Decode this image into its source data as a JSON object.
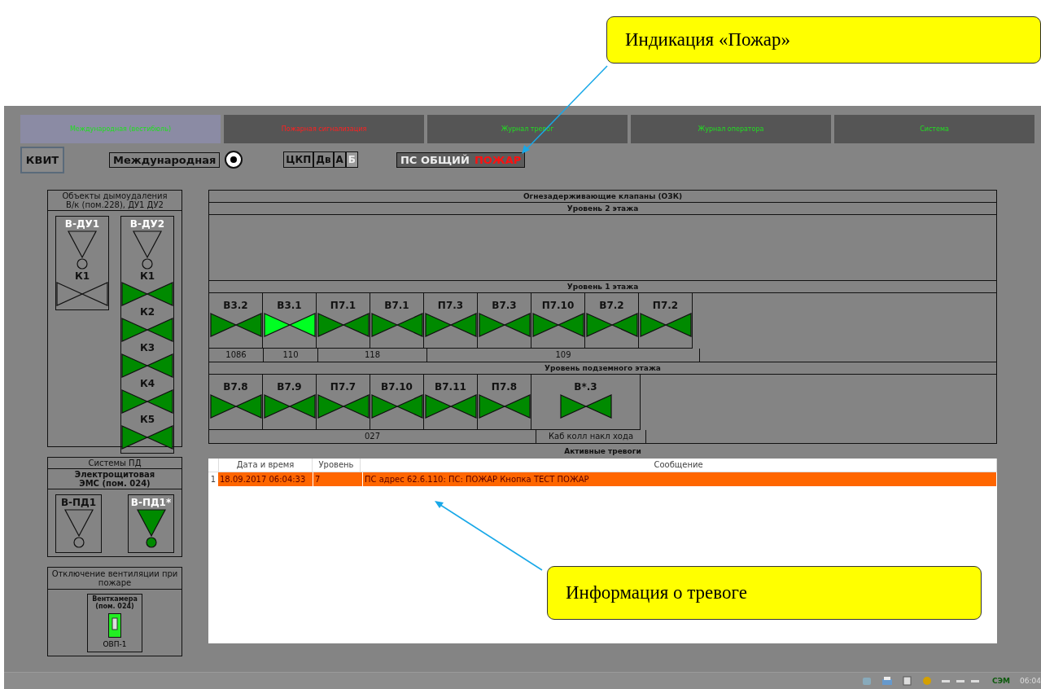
{
  "callouts": [
    {
      "text": "Индикация «Пожар»"
    },
    {
      "text": "Информация о тревоге"
    }
  ],
  "tabs": [
    {
      "label": "Международная (вестибюль)",
      "selected": true,
      "alert": false
    },
    {
      "label": "Пожарная сигнализация",
      "selected": false,
      "alert": true
    },
    {
      "label": "Журнал тревог",
      "selected": false,
      "alert": false
    },
    {
      "label": "Журнал оператора",
      "selected": false,
      "alert": false
    },
    {
      "label": "Система",
      "selected": false,
      "alert": false
    }
  ],
  "toolbar": {
    "ack_button": "КВИТ",
    "station": "Международная",
    "station_selected": true,
    "modes": [
      {
        "label": "ЦКП",
        "disabled": false
      },
      {
        "label": "Дв",
        "disabled": false
      },
      {
        "label": "А",
        "disabled": false
      },
      {
        "label": "Б",
        "disabled": true
      }
    ],
    "fire_panel": {
      "label": "ПС ОБЩИЙ",
      "alarm": "ПОЖАР"
    }
  },
  "smoke_panel": {
    "title": "Объекты дымоудаления",
    "subtitle": "В/к (пом.228), ДУ1 ДУ2",
    "units": [
      {
        "name": "В-ДУ1",
        "fan_on": false,
        "valves": [
          {
            "name": "К1",
            "kind": "off"
          }
        ]
      },
      {
        "name": "В-ДУ2",
        "fan_on": false,
        "valves": [
          {
            "name": "К1",
            "kind": "open"
          },
          {
            "name": "К2",
            "kind": "open"
          },
          {
            "name": "К3",
            "kind": "open"
          },
          {
            "name": "К4",
            "kind": "open"
          },
          {
            "name": "К5",
            "kind": "open"
          }
        ]
      }
    ]
  },
  "pd_panel": {
    "title": "Системы ПД",
    "subtitle": "Электрощитовая\nЭМС (пом. 024)",
    "units": [
      {
        "name": "В-ПД1",
        "fan_on": false
      },
      {
        "name": "В-ПД1*",
        "fan_on": true
      }
    ]
  },
  "vent_panel": {
    "title": "Отключение вентиляции при пожаре",
    "room": "Венткамера\n(пом. 024)",
    "switch_on": true,
    "switch_label": "ОВП-1"
  },
  "dampers": {
    "title": "Огнезадерживающие клапаны (ОЗК)",
    "levels": [
      {
        "title": "Уровень 2 этажа"
      },
      {
        "title": "Уровень 1 этажа",
        "rooms": [
          {
            "label": "1086",
            "valves": [
              {
                "name": "В3.2",
                "kind": "open"
              }
            ]
          },
          {
            "label": "110",
            "valves": [
              {
                "name": "В3.1",
                "kind": "active"
              }
            ]
          },
          {
            "label": "118",
            "valves": [
              {
                "name": "П7.1",
                "kind": "open"
              },
              {
                "name": "В7.1",
                "kind": "open"
              }
            ]
          },
          {
            "label": "109",
            "valves": [
              {
                "name": "П7.3",
                "kind": "open"
              },
              {
                "name": "В7.3",
                "kind": "open"
              },
              {
                "name": "П7.10",
                "kind": "open"
              },
              {
                "name": "В7.2",
                "kind": "open"
              },
              {
                "name": "П7.2",
                "kind": "open"
              }
            ]
          }
        ]
      },
      {
        "title": "Уровень подземного этажа",
        "rooms": [
          {
            "label": "027",
            "valves": [
              {
                "name": "В7.8",
                "kind": "open"
              },
              {
                "name": "В7.9",
                "kind": "open"
              },
              {
                "name": "П7.7",
                "kind": "open"
              },
              {
                "name": "В7.10",
                "kind": "open"
              },
              {
                "name": "В7.11",
                "kind": "open"
              },
              {
                "name": "П7.8",
                "kind": "open"
              }
            ]
          },
          {
            "label": "Каб колл накл хода",
            "valves": [
              {
                "name": "В*.3",
                "kind": "open",
                "wide": true
              }
            ]
          }
        ]
      }
    ]
  },
  "alarms": {
    "title": "Активные тревоги",
    "columns": [
      "Дата и время",
      "Уровень",
      "Сообщение"
    ],
    "rows": [
      {
        "number": "1",
        "time": "18.09.2017 06:04:33",
        "level": "7",
        "message": "ПС адрес 62.6.110: ПС:  ПОЖАР Кнопка ТЕСТ ПОЖАР",
        "selected": true
      }
    ]
  },
  "taskbar": {
    "label": "СЭМ",
    "clock": "06:04"
  }
}
